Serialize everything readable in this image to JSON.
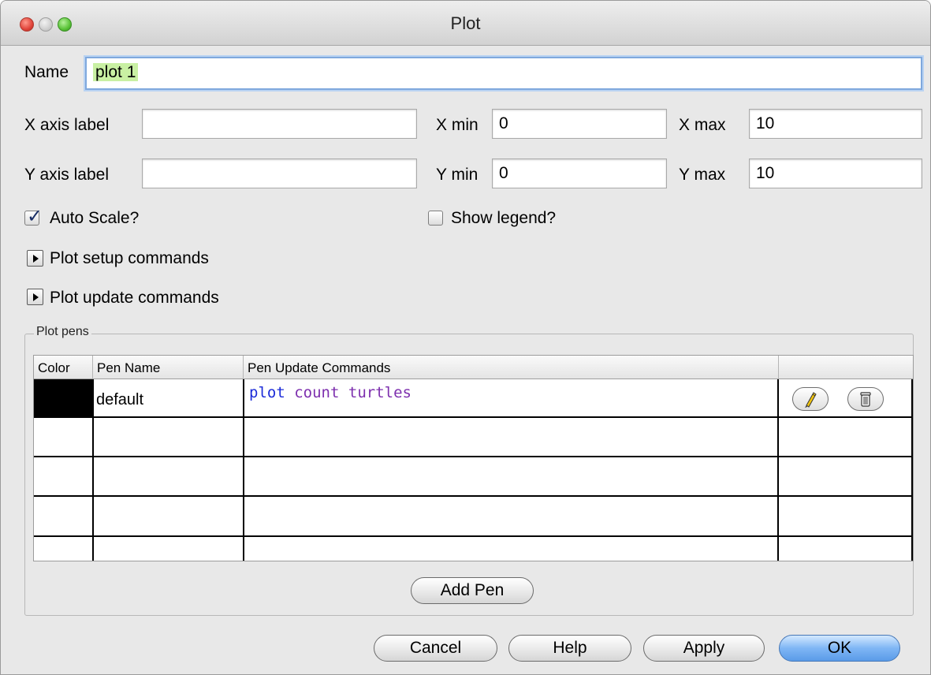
{
  "window": {
    "title": "Plot"
  },
  "form": {
    "name_label": "Name",
    "name_value": "plot 1",
    "x_axis_label": "X axis label",
    "x_axis_value": "",
    "y_axis_label": "Y axis label",
    "y_axis_value": "",
    "x_min_label": "X min",
    "x_min_value": "0",
    "x_max_label": "X max",
    "x_max_value": "10",
    "y_min_label": "Y min",
    "y_min_value": "0",
    "y_max_label": "Y max",
    "y_max_value": "10",
    "auto_scale_label": "Auto Scale?",
    "auto_scale_checked": true,
    "show_legend_label": "Show legend?",
    "show_legend_checked": false,
    "setup_commands_label": "Plot setup commands",
    "update_commands_label": "Plot update commands"
  },
  "pens": {
    "group_title": "Plot pens",
    "columns": [
      "Color",
      "Pen Name",
      "Pen Update Commands",
      ""
    ],
    "rows": [
      {
        "color": "#000000",
        "name": "default",
        "command_words": [
          "plot",
          "count",
          "turtles"
        ]
      }
    ],
    "row_icons": [
      "pencil-icon",
      "trash-icon"
    ],
    "add_pen_label": "Add Pen"
  },
  "buttons": {
    "cancel": "Cancel",
    "help": "Help",
    "apply": "Apply",
    "ok": "OK"
  },
  "colors": {
    "selection": "#c9f0a3",
    "keyword_primitive": "#1b2bd8",
    "keyword_reporter": "#7d2fae",
    "default_button": "#7fb6f5"
  }
}
